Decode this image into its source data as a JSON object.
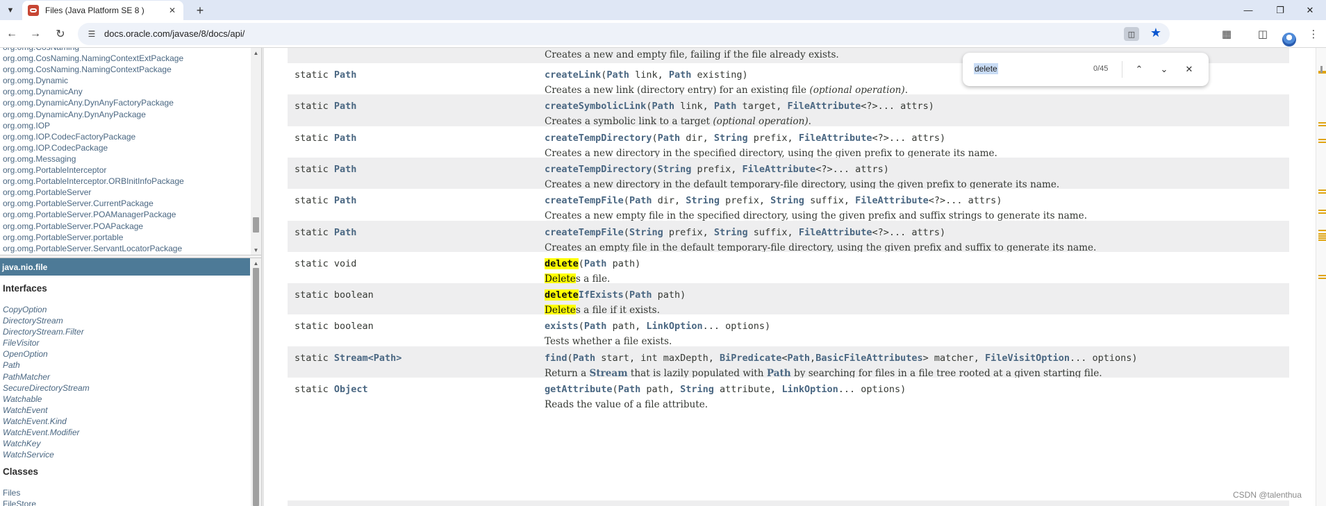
{
  "browser": {
    "tab_title": "Files (Java Platform SE 8 )",
    "url": "docs.oracle.com/javase/8/docs/api/",
    "icons": {
      "tab_menu": "chevron-down-icon",
      "new_tab": "plus-icon",
      "back": "back-arrow-icon",
      "forward": "forward-arrow-icon",
      "reload": "reload-icon",
      "site_info": "tune-icon",
      "lens": "google-lens-icon",
      "bookmark": "star-filled-icon",
      "extensions": "puzzle-icon",
      "side_panel": "side-panel-icon",
      "menu": "kebab-menu-icon"
    },
    "accent_color": "#0b57d0",
    "tabstrip_color": "#dfe7f5"
  },
  "find_bar": {
    "query": "delete",
    "count": "0/45"
  },
  "packages": [
    "org.omg.CosNaming",
    "org.omg.CosNaming.NamingContextExtPackage",
    "org.omg.CosNaming.NamingContextPackage",
    "org.omg.Dynamic",
    "org.omg.DynamicAny",
    "org.omg.DynamicAny.DynAnyFactoryPackage",
    "org.omg.DynamicAny.DynAnyPackage",
    "org.omg.IOP",
    "org.omg.IOP.CodecFactoryPackage",
    "org.omg.IOP.CodecPackage",
    "org.omg.Messaging",
    "org.omg.PortableInterceptor",
    "org.omg.PortableInterceptor.ORBInitInfoPackage",
    "org.omg.PortableServer",
    "org.omg.PortableServer.CurrentPackage",
    "org.omg.PortableServer.POAManagerPackage",
    "org.omg.PortableServer.POAPackage",
    "org.omg.PortableServer.portable",
    "org.omg.PortableServer.ServantLocatorPackage"
  ],
  "package_frame": {
    "title": "java.nio.file",
    "interfaces_heading": "Interfaces",
    "interfaces": [
      "CopyOption",
      "DirectoryStream",
      "DirectoryStream.Filter",
      "FileVisitor",
      "OpenOption",
      "Path",
      "PathMatcher",
      "SecureDirectoryStream",
      "Watchable",
      "WatchEvent",
      "WatchEvent.Kind",
      "WatchEvent.Modifier",
      "WatchKey",
      "WatchService"
    ],
    "classes_heading": "Classes",
    "classes": [
      "Files",
      "FileStore"
    ],
    "header_color": "#4d7a97"
  },
  "methods": {
    "first_description": "Creates a new and empty file, failing if the file already exists.",
    "rows": [
      {
        "type_prefix": "static ",
        "type_link": "Path",
        "sig": [
          [
            "name",
            "createLink"
          ],
          [
            "t",
            "("
          ],
          [
            "l",
            "Path"
          ],
          [
            "t",
            " link, "
          ],
          [
            "l",
            "Path"
          ],
          [
            "t",
            " existing)"
          ]
        ],
        "desc": [
          [
            "t",
            "Creates a new link (directory entry) for an existing file "
          ],
          [
            "e",
            "(optional operation)"
          ],
          [
            "t",
            "."
          ]
        ]
      },
      {
        "type_prefix": "static ",
        "type_link": "Path",
        "sig": [
          [
            "name",
            "createSymbolicLink"
          ],
          [
            "t",
            "("
          ],
          [
            "l",
            "Path"
          ],
          [
            "t",
            " link, "
          ],
          [
            "l",
            "Path"
          ],
          [
            "t",
            " target, "
          ],
          [
            "l",
            "FileAttribute"
          ],
          [
            "t",
            "<?>... attrs)"
          ]
        ],
        "desc": [
          [
            "t",
            "Creates a symbolic link to a target "
          ],
          [
            "e",
            "(optional operation)"
          ],
          [
            "t",
            "."
          ]
        ]
      },
      {
        "type_prefix": "static ",
        "type_link": "Path",
        "sig": [
          [
            "name",
            "createTempDirectory"
          ],
          [
            "t",
            "("
          ],
          [
            "l",
            "Path"
          ],
          [
            "t",
            " dir, "
          ],
          [
            "l",
            "String"
          ],
          [
            "t",
            " prefix, "
          ],
          [
            "l",
            "FileAttribute"
          ],
          [
            "t",
            "<?>... attrs)"
          ]
        ],
        "desc": [
          [
            "t",
            "Creates a new directory in the specified directory, using the given prefix to generate its name."
          ]
        ]
      },
      {
        "type_prefix": "static ",
        "type_link": "Path",
        "sig": [
          [
            "name",
            "createTempDirectory"
          ],
          [
            "t",
            "("
          ],
          [
            "l",
            "String"
          ],
          [
            "t",
            " prefix, "
          ],
          [
            "l",
            "FileAttribute"
          ],
          [
            "t",
            "<?>... attrs)"
          ]
        ],
        "desc": [
          [
            "t",
            "Creates a new directory in the default temporary-file directory, using the given prefix to generate its name."
          ]
        ]
      },
      {
        "type_prefix": "static ",
        "type_link": "Path",
        "sig": [
          [
            "name",
            "createTempFile"
          ],
          [
            "t",
            "("
          ],
          [
            "l",
            "Path"
          ],
          [
            "t",
            " dir, "
          ],
          [
            "l",
            "String"
          ],
          [
            "t",
            " prefix, "
          ],
          [
            "l",
            "String"
          ],
          [
            "t",
            " suffix, "
          ],
          [
            "l",
            "FileAttribute"
          ],
          [
            "t",
            "<?>... attrs)"
          ]
        ],
        "desc": [
          [
            "t",
            "Creates a new empty file in the specified directory, using the given prefix and suffix strings to generate its name."
          ]
        ]
      },
      {
        "type_prefix": "static ",
        "type_link": "Path",
        "sig": [
          [
            "name",
            "createTempFile"
          ],
          [
            "t",
            "("
          ],
          [
            "l",
            "String"
          ],
          [
            "t",
            " prefix, "
          ],
          [
            "l",
            "String"
          ],
          [
            "t",
            " suffix, "
          ],
          [
            "l",
            "FileAttribute"
          ],
          [
            "t",
            "<?>... attrs)"
          ]
        ],
        "desc": [
          [
            "t",
            "Creates an empty file in the default temporary-file directory, using the given prefix and suffix to generate its name."
          ]
        ]
      },
      {
        "type_prefix": "static void",
        "type_link": "",
        "sig": [
          [
            "hname",
            "delete"
          ],
          [
            "t",
            "("
          ],
          [
            "l",
            "Path"
          ],
          [
            "t",
            " path)"
          ]
        ],
        "desc": [
          [
            "h",
            "Delete"
          ],
          [
            "t",
            "s a file."
          ]
        ]
      },
      {
        "type_prefix": "static boolean",
        "type_link": "",
        "sig": [
          [
            "hname",
            "delete"
          ],
          [
            "name",
            "IfExists"
          ],
          [
            "t",
            "("
          ],
          [
            "l",
            "Path"
          ],
          [
            "t",
            " path)"
          ]
        ],
        "desc": [
          [
            "h",
            "Delete"
          ],
          [
            "t",
            "s a file if it exists."
          ]
        ]
      },
      {
        "type_prefix": "static boolean",
        "type_link": "",
        "sig": [
          [
            "name",
            "exists"
          ],
          [
            "t",
            "("
          ],
          [
            "l",
            "Path"
          ],
          [
            "t",
            " path, "
          ],
          [
            "l",
            "LinkOption"
          ],
          [
            "t",
            "... options)"
          ]
        ],
        "desc": [
          [
            "t",
            "Tests whether a file exists."
          ]
        ]
      },
      {
        "type_prefix": "static ",
        "type_link": "Stream<Path>",
        "sig": [
          [
            "name",
            "find"
          ],
          [
            "t",
            "("
          ],
          [
            "l",
            "Path"
          ],
          [
            "t",
            " start, int maxDepth, "
          ],
          [
            "l",
            "BiPredicate"
          ],
          [
            "t",
            "<"
          ],
          [
            "l",
            "Path"
          ],
          [
            "t",
            ","
          ],
          [
            "l",
            "BasicFileAttributes"
          ],
          [
            "t",
            "> matcher, "
          ],
          [
            "l",
            "FileVisitOption"
          ],
          [
            "t",
            "... options)"
          ]
        ],
        "desc": [
          [
            "t",
            "Return a "
          ],
          [
            "l",
            "Stream"
          ],
          [
            "t",
            " that is lazily populated with "
          ],
          [
            "l",
            "Path"
          ],
          [
            "t",
            " by searching for files in a file tree rooted at a given starting file."
          ]
        ]
      },
      {
        "type_prefix": "static ",
        "type_link": "Object",
        "sig": [
          [
            "name",
            "getAttribute"
          ],
          [
            "t",
            "("
          ],
          [
            "l",
            "Path"
          ],
          [
            "t",
            " path, "
          ],
          [
            "l",
            "String"
          ],
          [
            "t",
            " attribute, "
          ],
          [
            "l",
            "LinkOption"
          ],
          [
            "t",
            "... options)"
          ]
        ],
        "desc": [
          [
            "t",
            "Reads the value of a file attribute."
          ]
        ]
      }
    ],
    "link_color": "#4a6782",
    "highlight_color": "#ffff00",
    "row_alt_color": "#eeeeef"
  },
  "watermark": "CSDN @talenthua"
}
